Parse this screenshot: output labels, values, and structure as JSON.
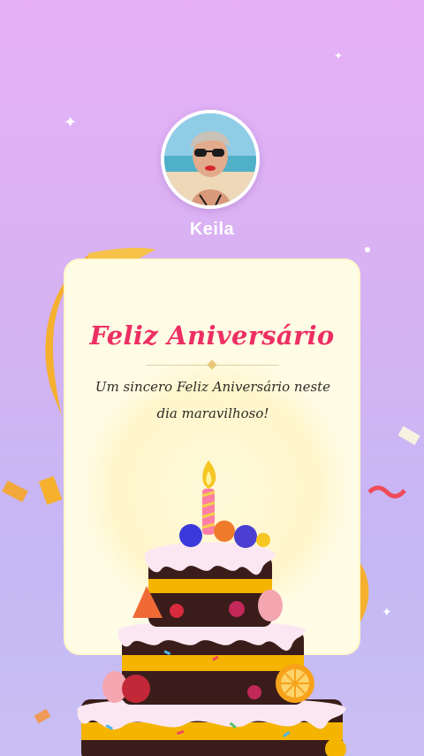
{
  "profile": {
    "name": "Keila"
  },
  "card": {
    "title": "Feliz Aniversário",
    "message": "Um sincero Feliz Aniversário neste dia maravilhoso!"
  },
  "colors": {
    "title": "#ee2f63",
    "card_background": "#fffce6",
    "ribbon": "#f7b733",
    "background_top": "#e7b0f6",
    "background_bottom": "#c9bff3"
  },
  "icons": {
    "sparkle": "four-point-star",
    "cake": "birthday-cake-with-candle"
  }
}
